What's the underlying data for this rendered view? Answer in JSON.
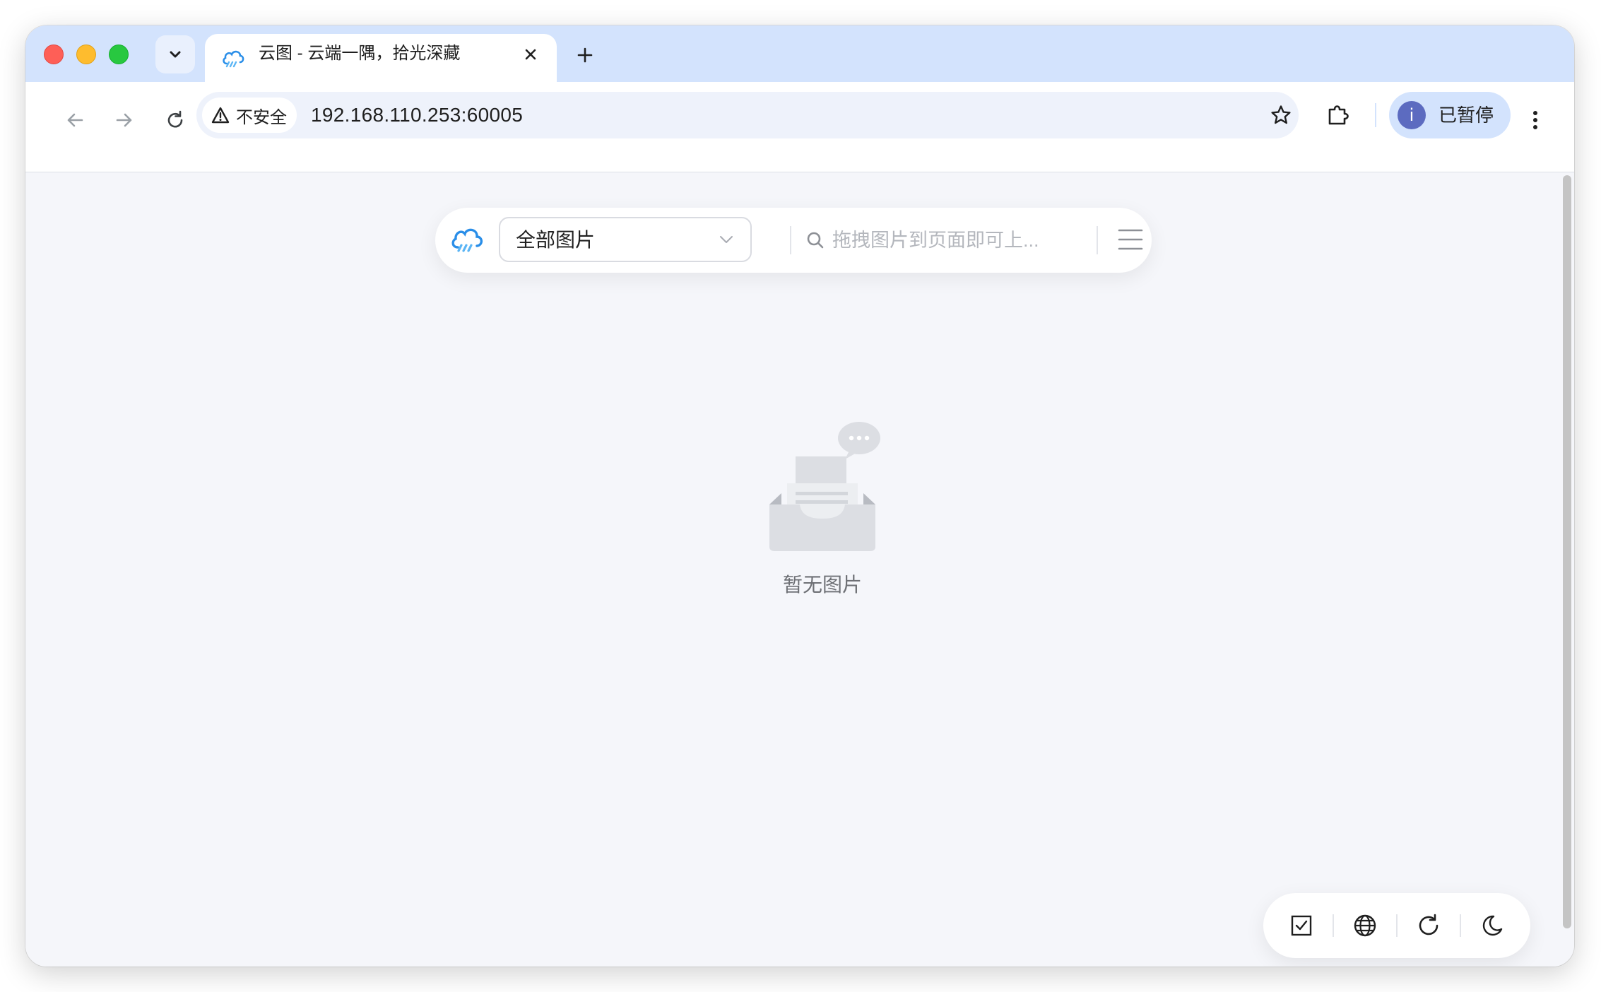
{
  "browser": {
    "tab": {
      "title": "云图 - 云端一隅，拾光深藏"
    },
    "address": {
      "security_label": "不安全",
      "url": "192.168.110.253:60005"
    },
    "profile": {
      "avatar_letter": "i",
      "status_label": "已暂停"
    },
    "colors": {
      "tabstrip": "#d3e3fd",
      "profile_chip": "#d3e3fd",
      "avatar": "#5c6bc0"
    }
  },
  "app": {
    "album_select": {
      "value": "全部图片"
    },
    "search": {
      "placeholder": "拖拽图片到页面即可上..."
    },
    "empty_state": {
      "text": "暂无图片"
    },
    "floating_toolbar": {
      "buttons": [
        "checkbox-icon",
        "globe-icon",
        "refresh-icon",
        "moon-icon"
      ]
    },
    "colors": {
      "page_background": "#f5f6fa",
      "logo_blue": "#2a8ee8"
    }
  }
}
